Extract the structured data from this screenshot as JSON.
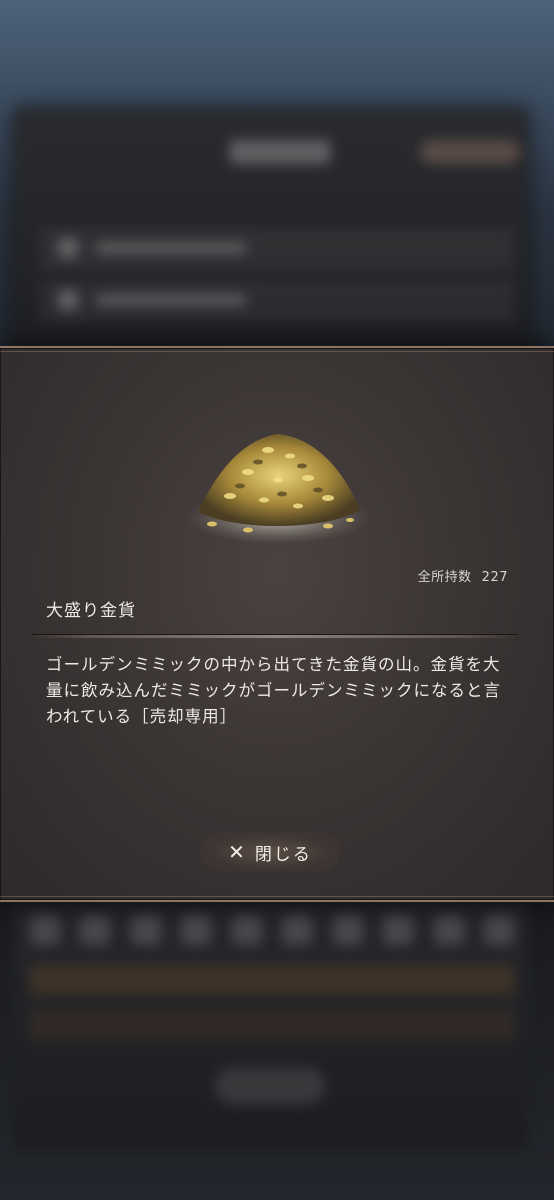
{
  "item": {
    "name": "大盛り金貨",
    "owned_label": "全所持数",
    "owned_count": "227",
    "description": "ゴールデンミミックの中から出てきた金貨の山。金貨を大量に飲み込んだミミックがゴールデンミミックになると言われている［売却専用］",
    "image_icon": "gold-coin-pile"
  },
  "close_button": {
    "label": "閉じる",
    "icon": "close-icon"
  },
  "colors": {
    "panel_border": "#8a7667",
    "panel_bg": "#3b3534",
    "text": "#eeeae6"
  }
}
